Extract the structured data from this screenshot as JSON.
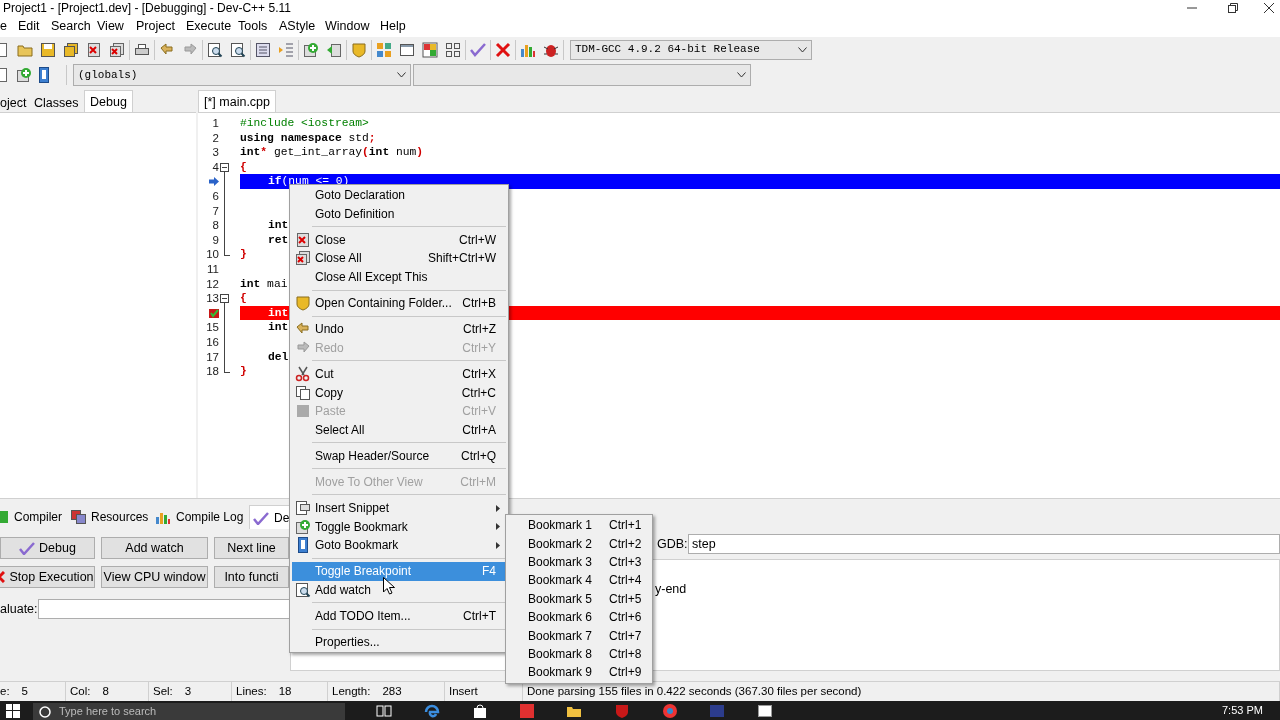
{
  "window": {
    "title": "Project1 - [Project1.dev] - [Debugging] - Dev-C++ 5.11"
  },
  "menu_bar": [
    "e",
    "Edit",
    "Search",
    "View",
    "Project",
    "Execute",
    "Tools",
    "AStyle",
    "Window",
    "Help"
  ],
  "toolbar": {
    "compiler": "TDM-GCC 4.9.2 64-bit Release"
  },
  "toolbar2": {
    "scope": "(globals)"
  },
  "left_panel": {
    "tabs": [
      {
        "label": "oject",
        "selected": false
      },
      {
        "label": "Classes",
        "selected": false
      },
      {
        "label": "Debug",
        "selected": true
      }
    ]
  },
  "editor": {
    "tab": {
      "label": "[*] main.cpp",
      "selected": true
    },
    "lines": [
      {
        "kind": "code",
        "number": "1",
        "tokens": [
          {
            "t": "#include <iostream>",
            "kind": "preproc"
          }
        ]
      },
      {
        "kind": "code",
        "number": "2",
        "tokens": [
          {
            "t": "using namespace",
            "kind": "keyword"
          },
          {
            "t": " std",
            "kind": "plain"
          },
          {
            "t": ";",
            "kind": "symbol"
          }
        ]
      },
      {
        "kind": "code",
        "number": "3",
        "tokens": [
          {
            "t": "int",
            "kind": "keyword"
          },
          {
            "t": "*",
            "kind": "symbol"
          },
          {
            "t": " get_int_array",
            "kind": "plain"
          },
          {
            "t": "(",
            "kind": "symbol"
          },
          {
            "t": "int",
            "kind": "keyword"
          },
          {
            "t": " num",
            "kind": "plain"
          },
          {
            "t": ")",
            "kind": "symbol"
          }
        ]
      },
      {
        "kind": "code",
        "number": "4",
        "fold_start": true,
        "tokens": [
          {
            "t": "{",
            "kind": "symbol"
          }
        ]
      },
      {
        "kind": "current",
        "indented": true,
        "tokens": [
          {
            "t": "if",
            "kind": "keyword"
          },
          {
            "t": "(",
            "kind": "symbol"
          },
          {
            "t": "num ",
            "kind": "plain"
          },
          {
            "t": "<=",
            "kind": "symbol"
          },
          {
            "t": " 0",
            "kind": "plain"
          },
          {
            "t": ")",
            "kind": "symbol"
          }
        ]
      },
      {
        "kind": "code",
        "number": "6"
      },
      {
        "kind": "code",
        "number": "7"
      },
      {
        "kind": "code",
        "number": "8",
        "indented": true,
        "tokens": [
          {
            "t": "int",
            "kind": "keyword"
          }
        ]
      },
      {
        "kind": "code",
        "number": "9",
        "indented": true,
        "tokens": [
          {
            "t": "ret",
            "kind": "keyword"
          }
        ]
      },
      {
        "kind": "code",
        "number": "10",
        "fold_end": true,
        "tokens": [
          {
            "t": "}",
            "kind": "symbol"
          }
        ]
      },
      {
        "kind": "code",
        "number": "11"
      },
      {
        "kind": "code",
        "number": "12",
        "tokens": [
          {
            "t": "int",
            "kind": "keyword"
          },
          {
            "t": " mai",
            "kind": "plain"
          }
        ]
      },
      {
        "kind": "code",
        "number": "13",
        "fold_start": true,
        "tokens": [
          {
            "t": "{",
            "kind": "symbol"
          }
        ]
      },
      {
        "kind": "breakpoint",
        "indented": true,
        "tokens": [
          {
            "t": "int",
            "kind": "keyword"
          }
        ]
      },
      {
        "kind": "code",
        "number": "15",
        "indented": true,
        "tokens": [
          {
            "t": "int",
            "kind": "keyword"
          }
        ]
      },
      {
        "kind": "code",
        "number": "16"
      },
      {
        "kind": "code",
        "number": "17",
        "indented": true,
        "tokens": [
          {
            "t": "del",
            "kind": "keyword"
          }
        ]
      },
      {
        "kind": "code",
        "number": "18",
        "fold_end": true,
        "tokens": [
          {
            "t": "}",
            "kind": "symbol"
          }
        ]
      }
    ]
  },
  "context_menu": [
    {
      "kind": "item",
      "label": "Goto Declaration",
      "disabled": false,
      "selected": false,
      "has_submenu": false
    },
    {
      "kind": "item",
      "label": "Goto Definition",
      "disabled": false,
      "selected": false,
      "has_submenu": false
    },
    {
      "kind": "separator"
    },
    {
      "kind": "item",
      "label": "Close",
      "shortcut": "Ctrl+W",
      "disabled": false,
      "selected": false,
      "has_submenu": false
    },
    {
      "kind": "item",
      "label": "Close All",
      "shortcut": "Shift+Ctrl+W",
      "disabled": false,
      "selected": false,
      "has_submenu": false
    },
    {
      "kind": "item",
      "label": "Close All Except This",
      "disabled": false,
      "selected": false,
      "has_submenu": false
    },
    {
      "kind": "separator"
    },
    {
      "kind": "item",
      "label": "Open Containing Folder...",
      "shortcut": "Ctrl+B",
      "disabled": false,
      "selected": false,
      "has_submenu": false
    },
    {
      "kind": "separator"
    },
    {
      "kind": "item",
      "label": "Undo",
      "shortcut": "Ctrl+Z",
      "disabled": false,
      "selected": false,
      "has_submenu": false
    },
    {
      "kind": "item",
      "label": "Redo",
      "shortcut": "Ctrl+Y",
      "disabled": true,
      "selected": false,
      "has_submenu": false
    },
    {
      "kind": "separator"
    },
    {
      "kind": "item",
      "label": "Cut",
      "shortcut": "Ctrl+X",
      "disabled": false,
      "selected": false,
      "has_submenu": false
    },
    {
      "kind": "item",
      "label": "Copy",
      "shortcut": "Ctrl+C",
      "disabled": false,
      "selected": false,
      "has_submenu": false
    },
    {
      "kind": "item",
      "label": "Paste",
      "shortcut": "Ctrl+V",
      "disabled": true,
      "selected": false,
      "has_submenu": false
    },
    {
      "kind": "item",
      "label": "Select All",
      "shortcut": "Ctrl+A",
      "disabled": false,
      "selected": false,
      "has_submenu": false
    },
    {
      "kind": "separator"
    },
    {
      "kind": "item",
      "label": "Swap Header/Source",
      "shortcut": "Ctrl+Q",
      "disabled": false,
      "selected": false,
      "has_submenu": false
    },
    {
      "kind": "separator"
    },
    {
      "kind": "item",
      "label": "Move To Other View",
      "shortcut": "Ctrl+M",
      "disabled": true,
      "selected": false,
      "has_submenu": false
    },
    {
      "kind": "separator"
    },
    {
      "kind": "item",
      "label": "Insert Snippet",
      "disabled": false,
      "selected": false,
      "has_submenu": true
    },
    {
      "kind": "item",
      "label": "Toggle Bookmark",
      "disabled": false,
      "selected": false,
      "has_submenu": true
    },
    {
      "kind": "item",
      "label": "Goto Bookmark",
      "disabled": false,
      "selected": false,
      "has_submenu": true
    },
    {
      "kind": "separator"
    },
    {
      "kind": "item",
      "label": "Toggle Breakpoint",
      "shortcut": "F4",
      "disabled": false,
      "selected": true,
      "has_submenu": false
    },
    {
      "kind": "item",
      "label": "Add watch",
      "disabled": false,
      "selected": false,
      "has_submenu": false
    },
    {
      "kind": "separator"
    },
    {
      "kind": "item",
      "label": "Add TODO Item...",
      "shortcut": "Ctrl+T",
      "disabled": false,
      "selected": false,
      "has_submenu": false
    },
    {
      "kind": "separator"
    },
    {
      "kind": "item",
      "label": "Properties...",
      "disabled": false,
      "selected": false,
      "has_submenu": false
    }
  ],
  "bookmark_submenu": [
    {
      "label": "Bookmark 1",
      "shortcut": "Ctrl+1"
    },
    {
      "label": "Bookmark 2",
      "shortcut": "Ctrl+2"
    },
    {
      "label": "Bookmark 3",
      "shortcut": "Ctrl+3"
    },
    {
      "label": "Bookmark 4",
      "shortcut": "Ctrl+4"
    },
    {
      "label": "Bookmark 5",
      "shortcut": "Ctrl+5"
    },
    {
      "label": "Bookmark 6",
      "shortcut": "Ctrl+6"
    },
    {
      "label": "Bookmark 7",
      "shortcut": "Ctrl+7"
    },
    {
      "label": "Bookmark 8",
      "shortcut": "Ctrl+8"
    },
    {
      "label": "Bookmark 9",
      "shortcut": "Ctrl+9"
    }
  ],
  "bottom_panel": {
    "tabs": [
      {
        "label": "Compiler",
        "selected": false
      },
      {
        "label": "Resources",
        "selected": false
      },
      {
        "label": "Compile Log",
        "selected": false
      },
      {
        "label": "De",
        "selected": true
      }
    ],
    "buttons": [
      {
        "label": "Debug"
      },
      {
        "label": "Add watch"
      },
      {
        "label": "Next line"
      },
      {
        "label": "Stop Execution"
      },
      {
        "label": "View CPU window"
      },
      {
        "label": "Into functi"
      }
    ],
    "evaluate_label": "aluate:",
    "gdb_label": "GDB:",
    "gdb_command": "step",
    "output": "y-end"
  },
  "status_bar": [
    {
      "label": "e:",
      "value": "5"
    },
    {
      "label": "Col:",
      "value": "8"
    },
    {
      "label": "Sel:",
      "value": "3"
    },
    {
      "label": "Lines:",
      "value": "18"
    },
    {
      "label": "Length:",
      "value": "283"
    },
    {
      "value": "Insert"
    },
    {
      "value": "Done parsing 155 files in 0.422 seconds (367.30 files per second)"
    }
  ],
  "taskbar": {
    "search_placeholder": "Type here to search",
    "time": "7:53 PM"
  }
}
